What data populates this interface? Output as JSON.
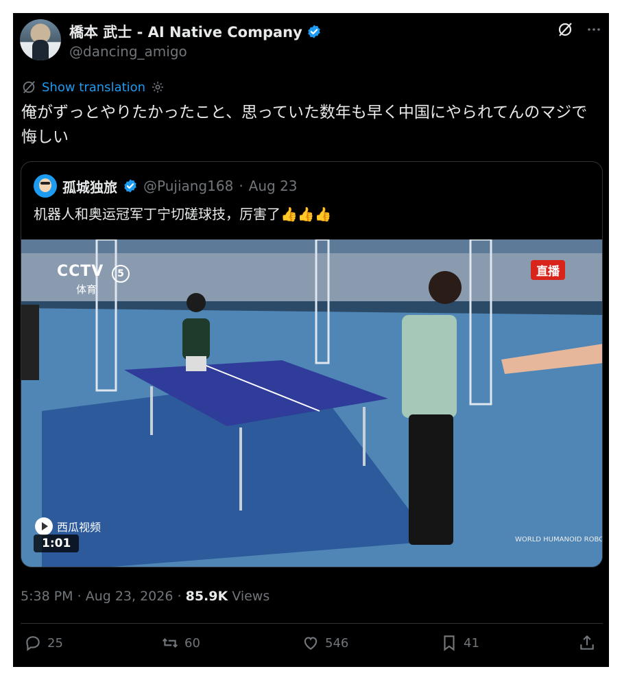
{
  "author": {
    "name": "橋本 武士 - AI Native Company",
    "handle": "@dancing_amigo",
    "verified": true
  },
  "translate_label": "Show translation",
  "tweet_text": "俺がずっとやりたかったこと、思っていた数年も早く中国にやられてんのマジで悔しい",
  "quoted": {
    "name": "孤城独旅",
    "handle": "@Pujiang168",
    "date": "Aug 23",
    "text": "机器人和奥运冠军丁宁切磋球技，厉害了👍👍👍",
    "video": {
      "live_badge": "直播",
      "channel_logo": "CCTV",
      "channel_number": "5",
      "channel_sub": "体育",
      "watermark": "西瓜视频",
      "duration": "1:01"
    }
  },
  "meta": {
    "time": "5:38 PM",
    "date": "Aug 23, 2026",
    "views_count": "85.9K",
    "views_label": "Views",
    "sep": "·"
  },
  "actions": {
    "reply_count": "25",
    "repost_count": "60",
    "like_count": "546",
    "bookmark_count": "41"
  },
  "colors": {
    "background": "#000000",
    "accent": "#1d9bf0",
    "muted": "#71767b",
    "text": "#e7e9ea",
    "border": "#2f3336"
  }
}
